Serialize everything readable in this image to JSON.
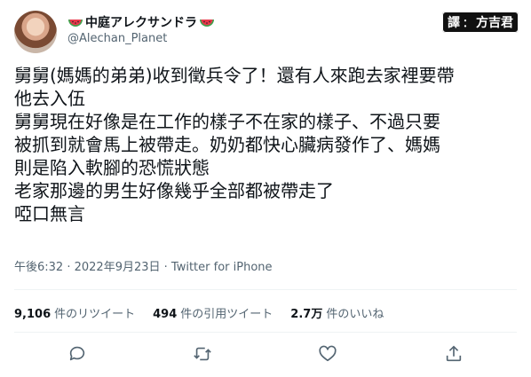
{
  "author": {
    "display_name": "中庭アレクサンドラ",
    "handle": "@Alechan_Planet",
    "avatar_icon": "profile-avatar",
    "name_emoji_icon": "watermelon-icon"
  },
  "translator_badge": {
    "prefix": "譯",
    "separator": "：",
    "name": "方吉君"
  },
  "tweet": {
    "lines": [
      "舅舅(媽媽的弟弟)收到徵兵令了！還有人來跑去家裡要帶",
      "他去入伍",
      "舅舅現在好像是在工作的樣子不在家的樣子、不過只要",
      "被抓到就會馬上被帶走。奶奶都快心臟病發作了、媽媽",
      "則是陷入軟腳的恐慌狀態",
      "老家那邊的男生好像幾乎全部都被帶走了",
      "啞口無言"
    ],
    "time": "午後6:32",
    "date": "2022年9月23日",
    "separator": " · ",
    "source": "Twitter for iPhone"
  },
  "stats": [
    {
      "count": "9,106",
      "label": "件のリツイート"
    },
    {
      "count": "494",
      "label": "件の引用ツイート"
    },
    {
      "count": "2.7万",
      "label": "件のいいね"
    }
  ],
  "actions": [
    {
      "name": "reply-icon"
    },
    {
      "name": "retweet-icon"
    },
    {
      "name": "like-icon"
    },
    {
      "name": "share-icon"
    }
  ]
}
